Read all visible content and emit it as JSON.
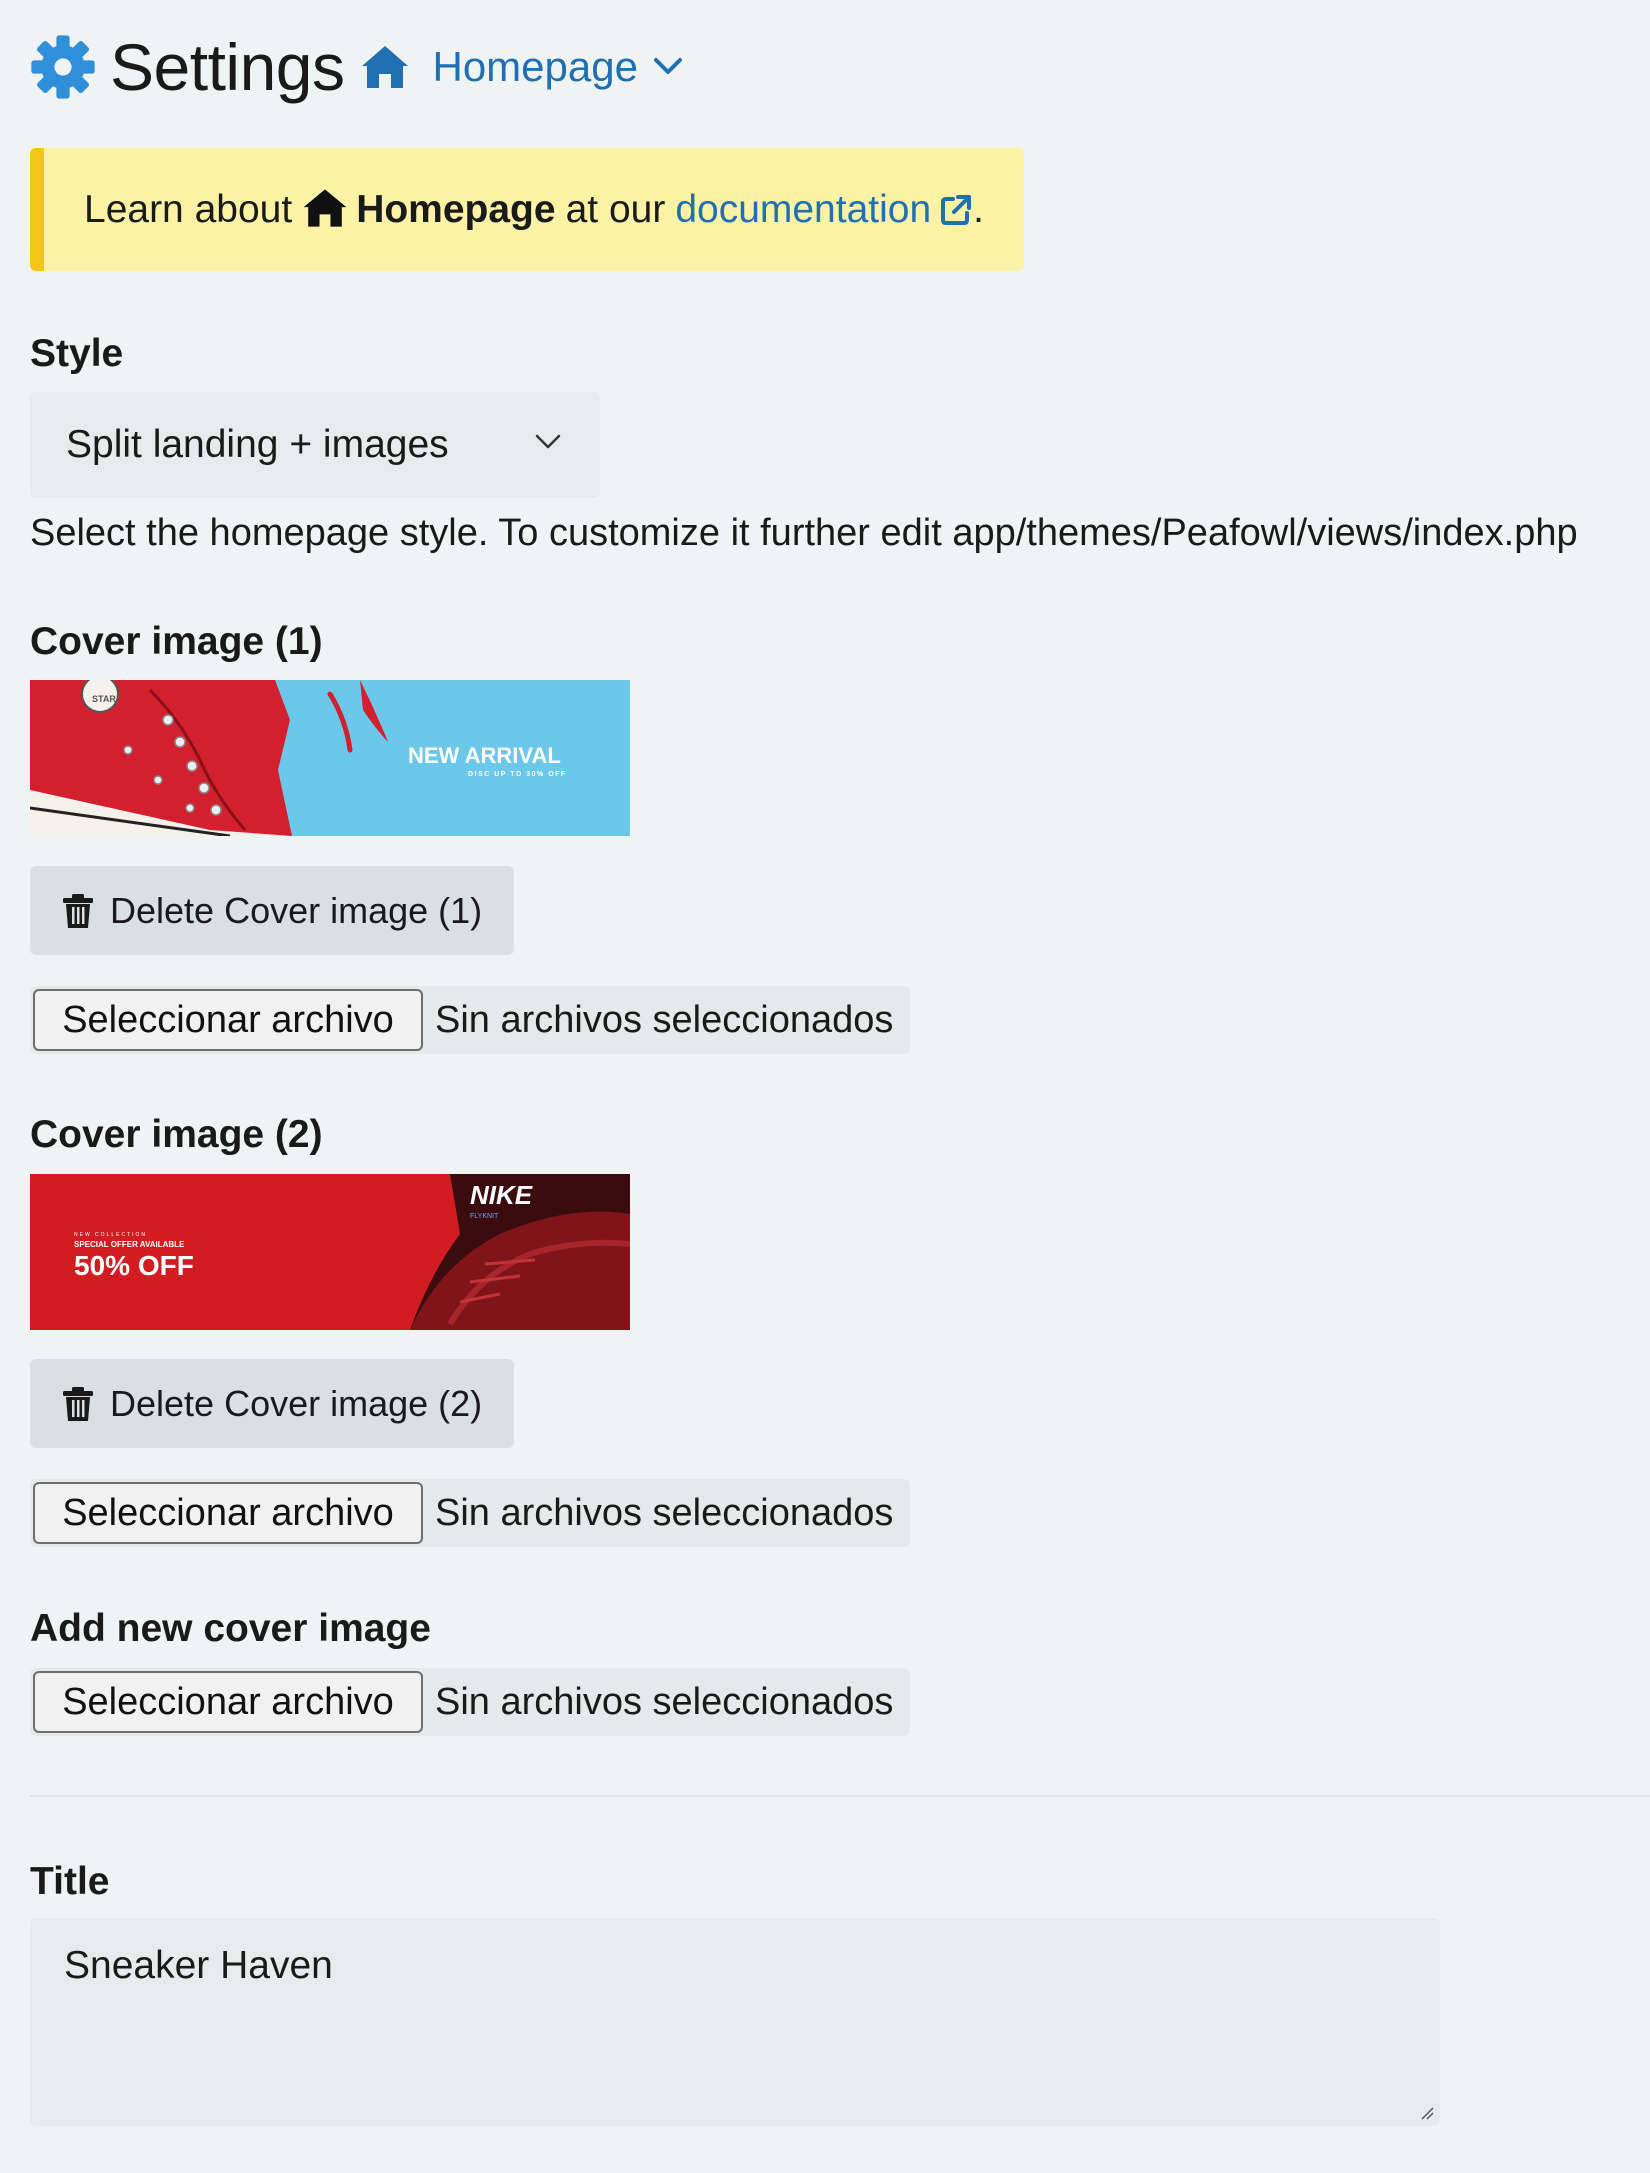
{
  "header": {
    "title": "Settings",
    "breadcrumb": "Homepage",
    "icons": [
      "gear-icon",
      "home-icon",
      "chevron-down-icon"
    ],
    "accent_color": "#1f6fb2"
  },
  "notice": {
    "prefix": "Learn about",
    "bold": "Homepage",
    "middle": "at our",
    "link": "documentation",
    "suffix": ".",
    "background": "#fbf2a6",
    "border_color": "#f5c518"
  },
  "style_field": {
    "label": "Style",
    "value": "Split landing + images",
    "help": "Select the homepage style. To customize it further edit app/themes/Peafowl/views/index.php"
  },
  "cover1": {
    "label": "Cover image (1)",
    "banner_title": "NEW ARRIVAL",
    "banner_sub": "DISC UP TO 30% OFF",
    "banner_brand": "STAR",
    "delete_label": "Delete Cover image (1)",
    "file_button": "Seleccionar archivo",
    "file_status": "Sin archivos seleccionados"
  },
  "cover2": {
    "label": "Cover image (2)",
    "banner_kicker": "NEW COLLECTION",
    "banner_sub": "SPECIAL OFFER AVAILABLE",
    "banner_title": "50% OFF",
    "banner_brand": "NIKE",
    "banner_brand_sub": "FLYKNIT",
    "delete_label": "Delete Cover image (2)",
    "file_button": "Seleccionar archivo",
    "file_status": "Sin archivos seleccionados"
  },
  "new_cover": {
    "label": "Add new cover image",
    "file_button": "Seleccionar archivo",
    "file_status": "Sin archivos seleccionados"
  },
  "title_field": {
    "label": "Title",
    "value": "Sneaker Haven"
  }
}
